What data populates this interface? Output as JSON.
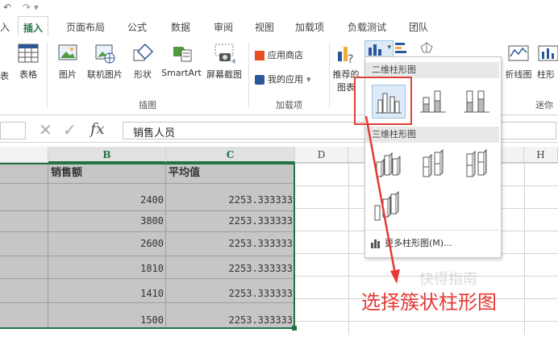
{
  "quick_access": {
    "undo": "↶",
    "redo": "↷ ▾"
  },
  "tabs": [
    {
      "label": "插入",
      "active": true
    },
    {
      "label": "页面布局"
    },
    {
      "label": "公式"
    },
    {
      "label": "数据"
    },
    {
      "label": "审阅"
    },
    {
      "label": "视图"
    },
    {
      "label": "加载项"
    },
    {
      "label": "负载测试"
    },
    {
      "label": "团队"
    }
  ],
  "ribbon": {
    "left_partial": "表",
    "table": "表格",
    "picture": "图片",
    "online_picture": "联机图片",
    "shapes": "形状",
    "smartart": "SmartArt",
    "screenshot": "屏幕截图",
    "group_illustrations": "插图",
    "app_store": "应用商店",
    "my_apps": "我的应用",
    "group_addins": "加载项",
    "recommended_line1": "推荐的",
    "recommended_line2": "图表",
    "line_chart": "折线图",
    "column_partial": "柱形",
    "group_sparklines": "迷你"
  },
  "formula_bar": {
    "value": "销售人员"
  },
  "columns": [
    {
      "label": "B",
      "selected": true
    },
    {
      "label": "C",
      "selected": true
    },
    {
      "label": "D"
    },
    {
      "label": "H"
    }
  ],
  "table": {
    "headers": [
      "销售额",
      "平均值"
    ],
    "rows": [
      [
        "2400",
        "2253.333333"
      ],
      [
        "3800",
        "2253.333333"
      ],
      [
        "2600",
        "2253.333333"
      ],
      [
        "1810",
        "2253.333333"
      ],
      [
        "1410",
        "2253.333333"
      ],
      [
        "1500",
        "2253.333333"
      ]
    ]
  },
  "dropdown": {
    "section_2d": "二维柱形图",
    "section_3d": "三维柱形图",
    "more": "更多柱形图(M)..."
  },
  "annotation": "选择簇状柱形图",
  "watermark": "快得指南",
  "colors": {
    "accent": "#217346",
    "highlight": "#e0403a",
    "selection": "#c6c6c6"
  }
}
